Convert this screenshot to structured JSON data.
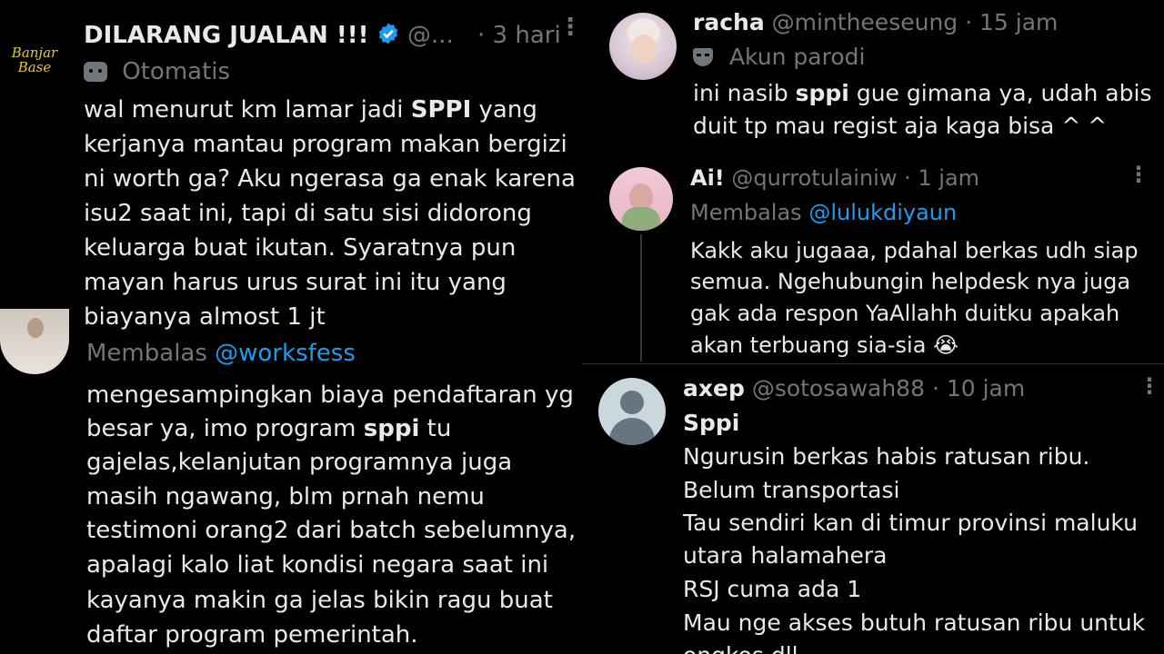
{
  "left": {
    "author": {
      "name": "DILARANG JUALAN !!!",
      "handle": "@...",
      "time": "· 3 hari",
      "label": "Otomatis",
      "avatar_text": "Banjar Base"
    },
    "tweet_lines": [
      "wal menurut km lamar jadi ",
      "SPPI",
      " yang",
      "kerjanya mantau program makan bergizi",
      "ni worth ga? Aku ngerasa ga enak karena",
      "isu2 saat ini, tapi di satu sisi didorong",
      "keluarga buat ikutan. Syaratnya pun",
      "mayan harus urus surat ini itu yang",
      "biayanya almost 1 jt"
    ],
    "reply": {
      "replying_label": "Membalas",
      "replying_to": "@worksfess",
      "lines": [
        "mengesampingkan biaya pendaftaran yg",
        "besar ya, imo program ",
        "sppi",
        " tu",
        "gajelas,kelanjutan programnya juga",
        "masih ngawang,  blm prnah nemu",
        "testimoni orang2 dari batch sebelumnya,",
        "apalagi kalo liat kondisi negara saat ini",
        "kayanya makin ga jelas bikin ragu buat",
        "daftar program pemerintah."
      ]
    }
  },
  "right_top": {
    "name": "racha",
    "handle": "@mintheeseung",
    "time": "· 15 jam",
    "label": "Akun parodi",
    "lines": [
      "ini nasib ",
      "sppi",
      " gue gimana ya, udah abis",
      "duit tp mau regist aja kaga bisa ^ ^"
    ]
  },
  "right_mid": {
    "name": "Ai!",
    "handle": "@qurrotulainiw",
    "time": "· 1 jam",
    "replying_label": "Membalas",
    "replying_to": "@lulukdiyaun",
    "lines": [
      "Kakk aku jugaaa, pdahal berkas udh siap",
      "semua. Ngehubungin helpdesk nya juga",
      "gak ada respon YaAllahh duitku apakah",
      "akan terbuang sia-sia 😭"
    ]
  },
  "right_bot": {
    "name": "axep",
    "handle": "@sotosawah88",
    "time": "· 10 jam",
    "lines": [
      "Sppi",
      "Ngurusin berkas habis ratusan ribu.",
      "Belum transportasi",
      "Tau sendiri kan di timur provinsi maluku",
      "utara halamahera",
      "RSJ cuma ada 1",
      "Mau nge akses butuh ratusan ribu untuk",
      "ongkos dll"
    ]
  },
  "colors": {
    "background": "#000000",
    "text": "#e7e9ea",
    "muted": "#71767b",
    "link": "#1d9bf0",
    "verified": "#1d9bf0"
  }
}
